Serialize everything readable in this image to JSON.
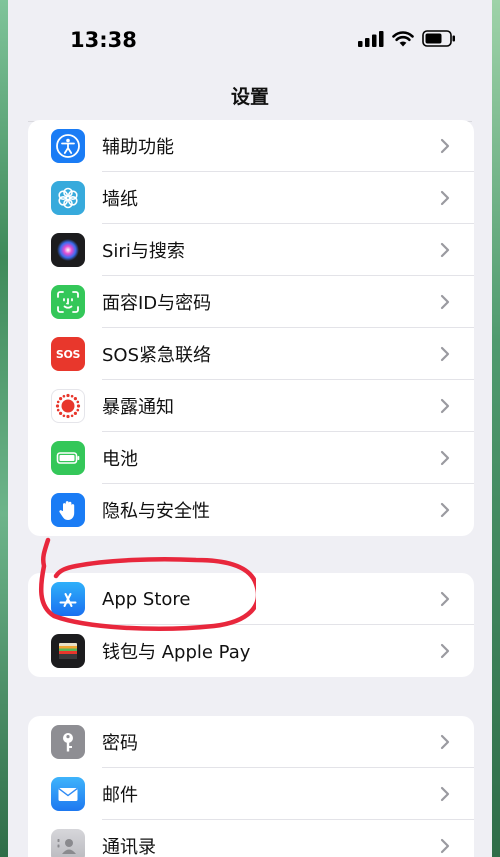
{
  "status_bar": {
    "time": "13:38"
  },
  "nav": {
    "title": "设置"
  },
  "group1": {
    "items": [
      {
        "label": "辅助功能",
        "icon": "accessibility-icon"
      },
      {
        "label": "墙纸",
        "icon": "wallpaper-icon"
      },
      {
        "label": "Siri与搜索",
        "icon": "siri-icon"
      },
      {
        "label": "面容ID与密码",
        "icon": "face-id-icon"
      },
      {
        "label": "SOS紧急联络",
        "icon": "sos-icon",
        "icon_text": "SOS"
      },
      {
        "label": "暴露通知",
        "icon": "exposure-notification-icon"
      },
      {
        "label": "电池",
        "icon": "battery-icon"
      },
      {
        "label": "隐私与安全性",
        "icon": "privacy-hand-icon"
      }
    ]
  },
  "group2": {
    "items": [
      {
        "label": "App Store",
        "icon": "app-store-icon"
      },
      {
        "label": "钱包与 Apple Pay",
        "icon": "wallet-icon"
      }
    ]
  },
  "group3": {
    "items": [
      {
        "label": "密码",
        "icon": "key-icon"
      },
      {
        "label": "邮件",
        "icon": "mail-icon"
      },
      {
        "label": "通讯录",
        "icon": "contacts-icon"
      }
    ]
  },
  "colors": {
    "accessibility": "#1a7cf5",
    "wallpaper": "#37aadc",
    "siri": "#1c1c1e",
    "face_id": "#34c759",
    "sos": "#e8372c",
    "exposure": "#ffffff",
    "battery": "#34c759",
    "privacy": "#1a7cf5",
    "app_store": "#1c8ef5",
    "wallet": "#1c1c1e",
    "passwords": "#8e8e93",
    "mail": "#2d8af5",
    "contacts": "#b8b8bd",
    "annotation": "#e8273c"
  }
}
